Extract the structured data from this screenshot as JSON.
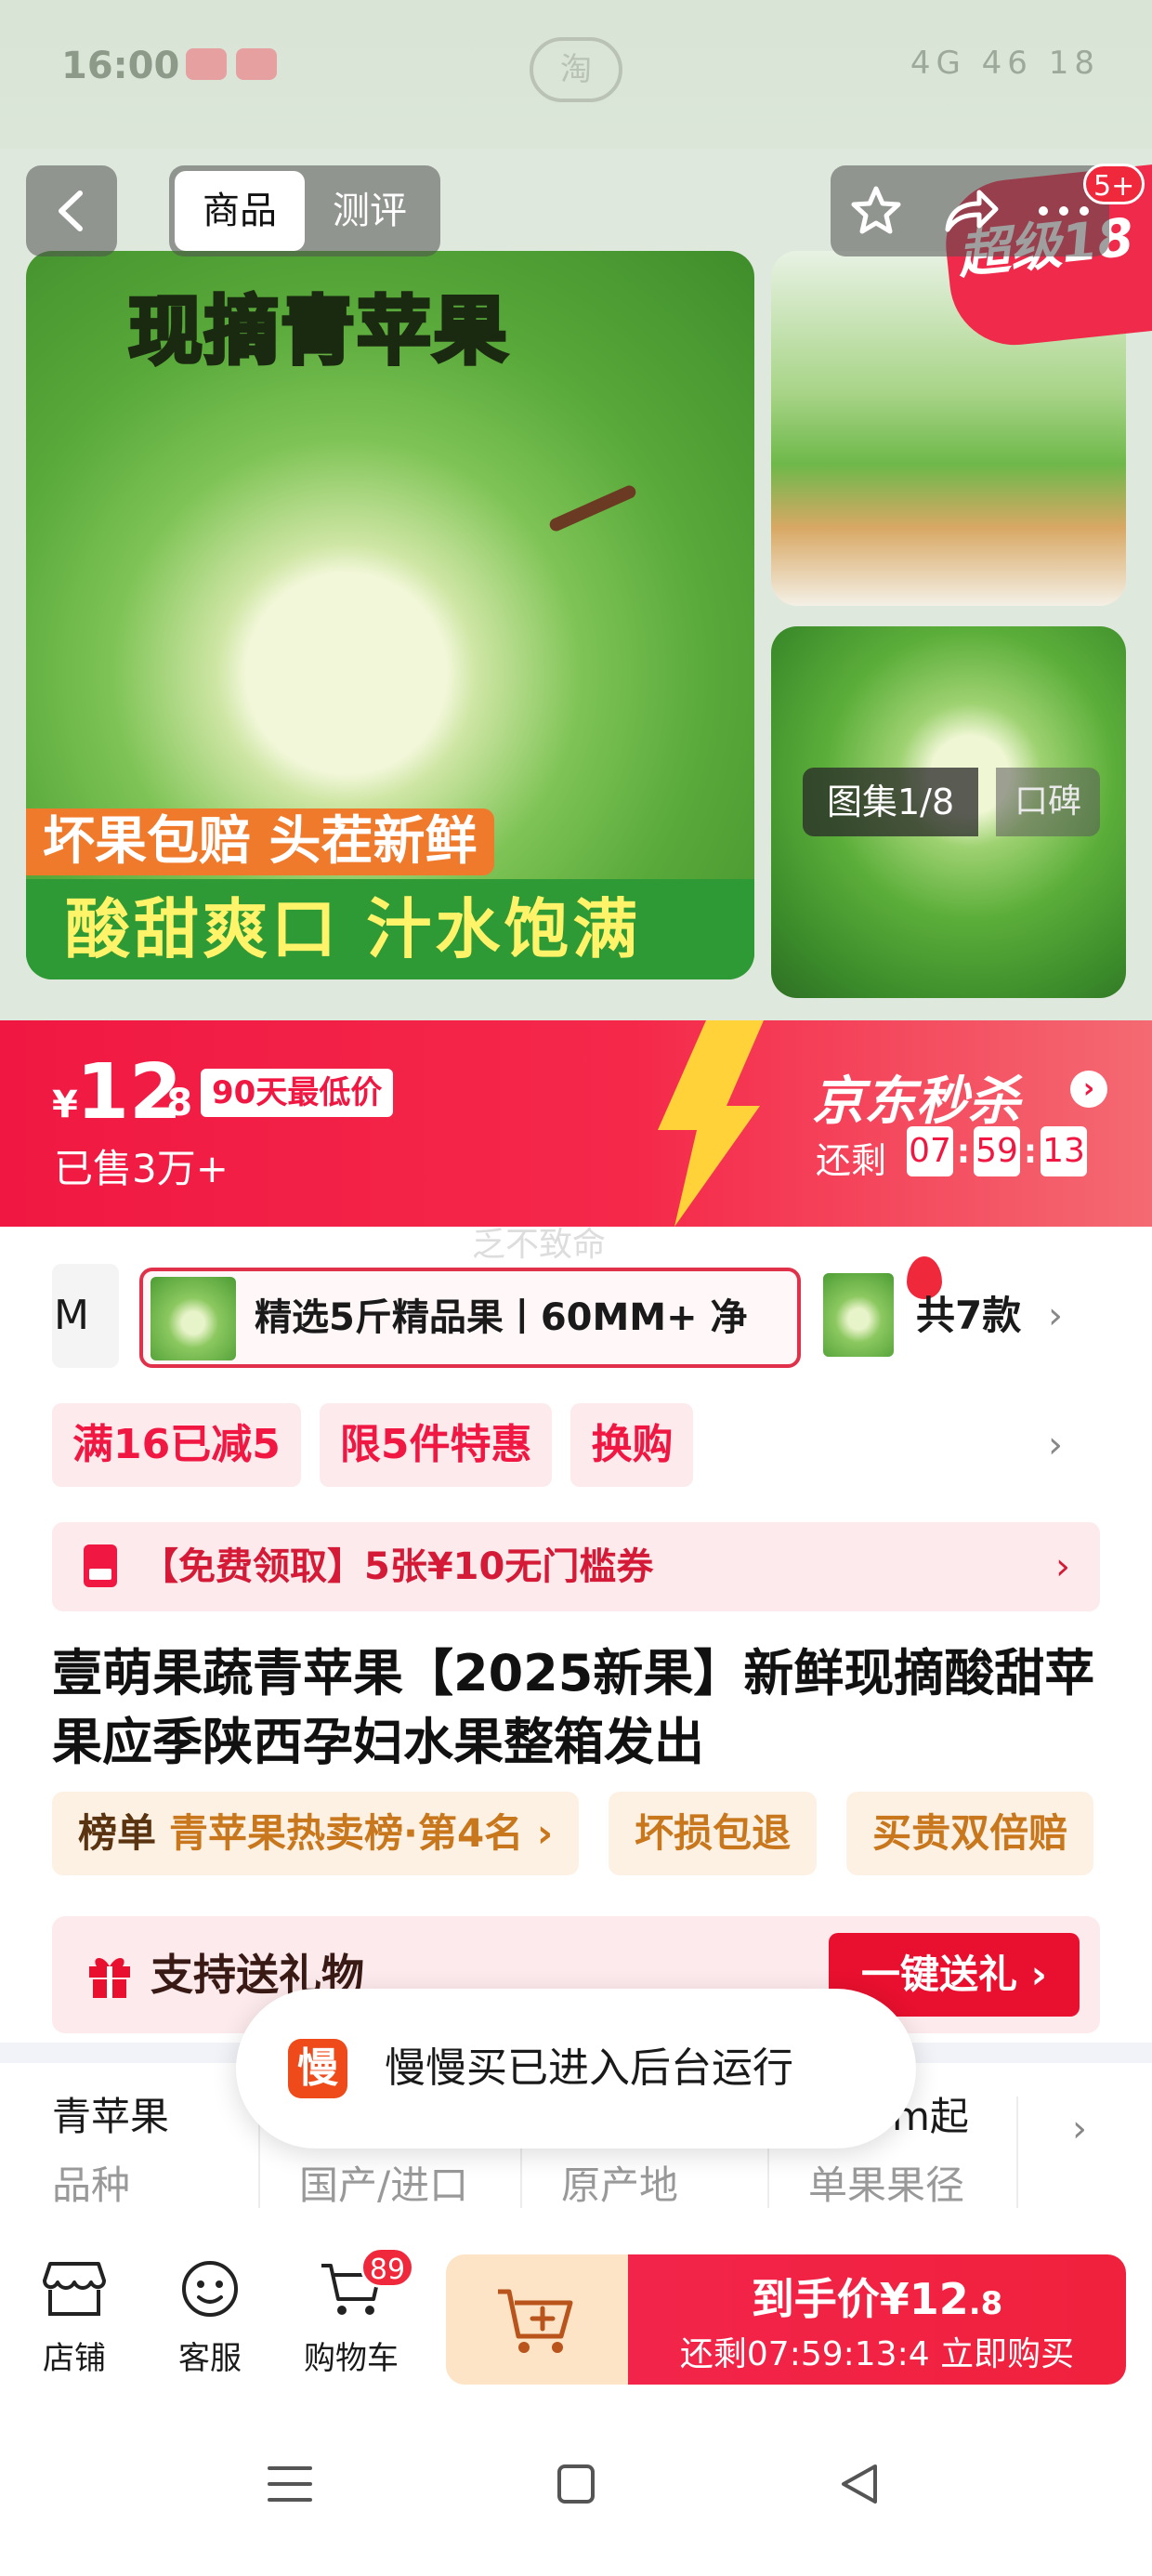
{
  "status_bar": {
    "time": "16:00",
    "center_app": "淘",
    "right_text": "4G 46 18"
  },
  "nav": {
    "tabs": [
      {
        "label": "商品",
        "active": true
      },
      {
        "label": "测评",
        "active": false
      }
    ],
    "badge": "5+"
  },
  "gallery": {
    "main_title": "现摘青苹果",
    "banner_orange": "坏果包赔 头茬新鲜",
    "banner_green": "酸甜爽口 汁水饱满",
    "tag_super": "超级18",
    "counter": "图集1/8",
    "review_chip": "口碑"
  },
  "price": {
    "currency": "¥",
    "integer": "12",
    "decimal": ".8",
    "lowest_badge": "90天最低价",
    "sold": "已售3万+"
  },
  "flash_sale": {
    "title": "京东秒杀",
    "remaining_label": "还剩",
    "hours": "07",
    "minutes": "59",
    "seconds": "13"
  },
  "watermark": "乏不致命",
  "sku": {
    "prev_label": "M",
    "selected_label": "精选5斤精品果丨60MM+ 净",
    "total": "共7款"
  },
  "promos": [
    "满16已减5",
    "限5件特惠",
    "换购"
  ],
  "coupon": {
    "text": "【免费领取】5张¥10无门槛券"
  },
  "product": {
    "title": "壹萌果蔬青苹果【2025新果】新鲜现摘酸甜苹果应季陕西孕妇水果整箱发出"
  },
  "rank": {
    "head": "榜单",
    "body": "青苹果热卖榜·第4名 ›",
    "chips": [
      "坏损包退",
      "买贵双倍赔"
    ]
  },
  "gift": {
    "label": "支持送礼物",
    "button": "一键送礼 ›"
  },
  "specs": [
    {
      "value": "青苹果",
      "key": "品种"
    },
    {
      "value": "",
      "key": "国产/进口"
    },
    {
      "value": "",
      "key": "原产地"
    },
    {
      "value": "m起",
      "key": "单果果径"
    }
  ],
  "toast": {
    "logo": "慢",
    "text": "慢慢买已进入后台运行"
  },
  "bottom_bar": {
    "shop": "店铺",
    "service": "客服",
    "cart": "购物车",
    "cart_count": "89",
    "buy_price_label": "到手价¥12",
    "buy_price_decimal": ".8",
    "buy_sub": "还剩07:59:13:4  立即购买"
  },
  "colors": {
    "brand_red": "#f01842",
    "apple_green": "#5cae3a",
    "rank_orange": "#c8771c"
  }
}
